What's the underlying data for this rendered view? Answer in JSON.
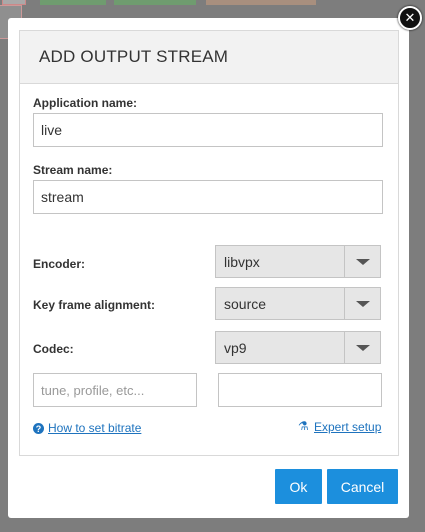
{
  "modal": {
    "title": "ADD OUTPUT STREAM",
    "close_icon": "close-icon"
  },
  "form": {
    "application_name": {
      "label": "Application name:",
      "value": "live"
    },
    "stream_name": {
      "label": "Stream name:",
      "value": "stream"
    },
    "encoder": {
      "label": "Encoder:",
      "value": "libvpx"
    },
    "key_frame_alignment": {
      "label": "Key frame alignment:",
      "value": "source"
    },
    "codec": {
      "label": "Codec:",
      "value": "vp9"
    },
    "extra_params": {
      "placeholder": "tune, profile, etc...",
      "value": ""
    },
    "bitrate": {
      "value": ""
    }
  },
  "links": {
    "how_to_bitrate": {
      "label": "How to set bitrate",
      "icon": "question-circle-icon"
    },
    "expert_setup": {
      "label": "Expert setup",
      "icon": "flask-icon"
    }
  },
  "buttons": {
    "ok": "Ok",
    "cancel": "Cancel"
  },
  "colors": {
    "accent": "#1c8fdd",
    "link": "#1e73be",
    "header_bg": "#f2f2f2"
  }
}
